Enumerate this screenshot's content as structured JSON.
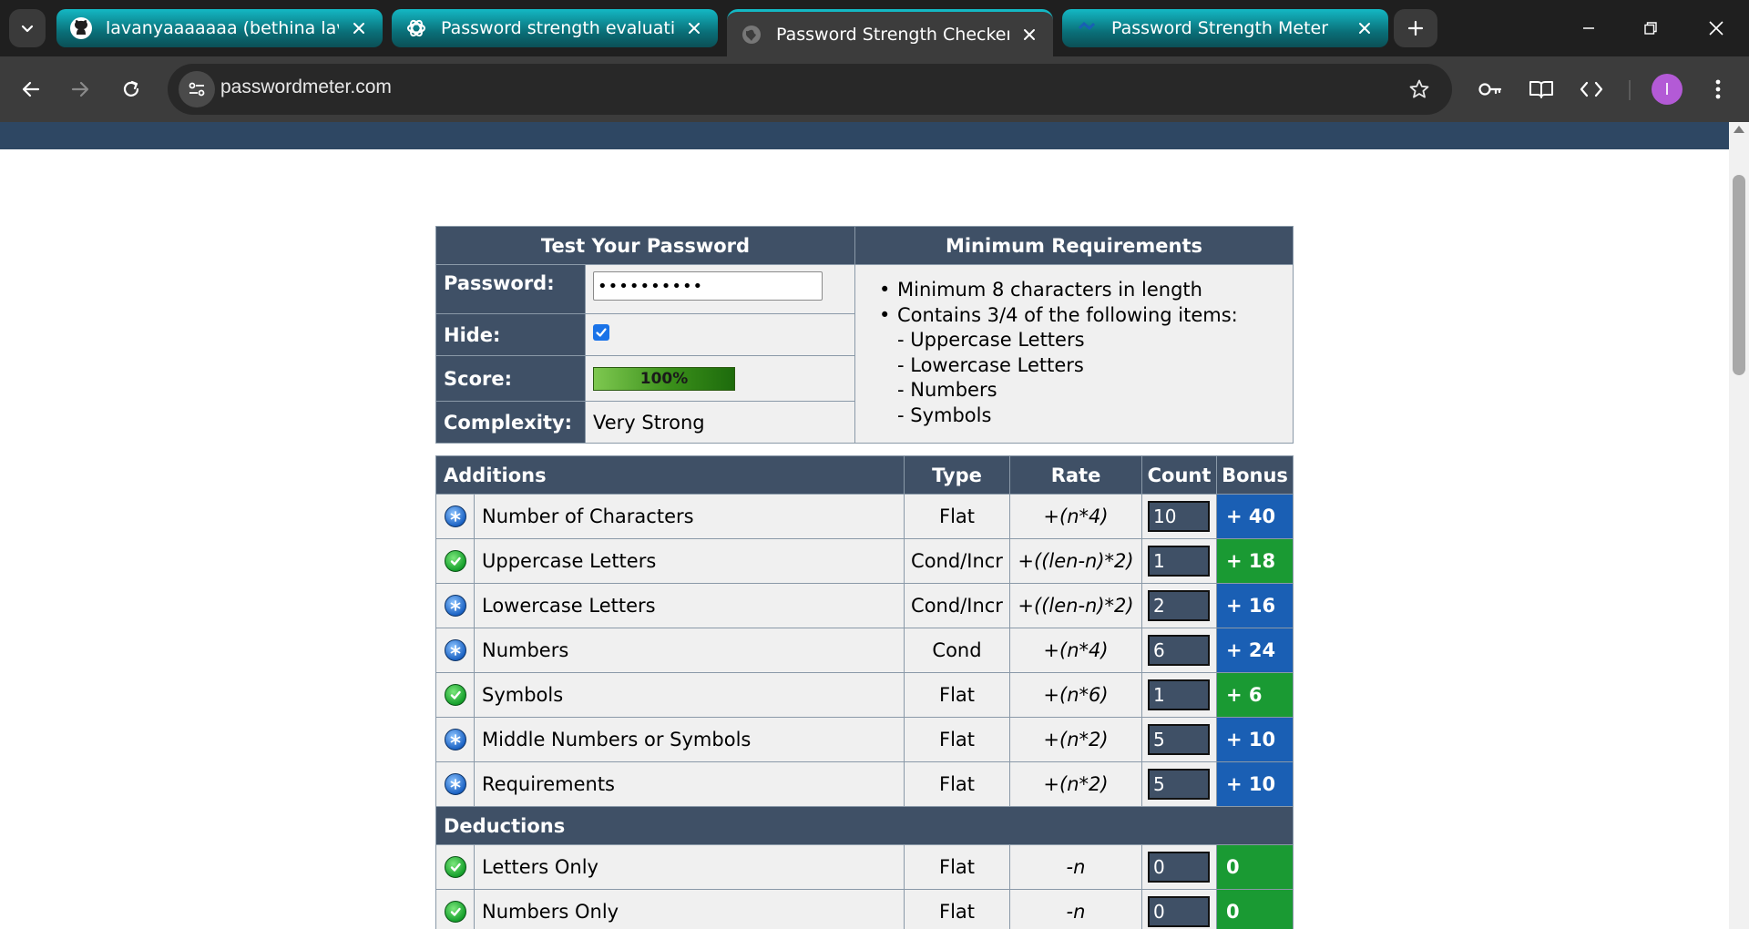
{
  "browser": {
    "tabs": [
      {
        "title": "lavanyaaaaaaa (bethina lavanya",
        "favicon": "github-icon",
        "style": "green"
      },
      {
        "title": "Password strength evaluation",
        "favicon": "openai-icon",
        "style": "green"
      },
      {
        "title": "Password Strength Checker",
        "favicon": "globe-icon",
        "style": "active"
      },
      {
        "title": "Password Strength Meter",
        "favicon": "site-icon",
        "style": "green"
      }
    ],
    "url": "passwordmeter.com",
    "profile_initial": "I",
    "accent_color": "#14b8c4"
  },
  "test_panel": {
    "header": "Test Your Password",
    "password_label": "Password:",
    "password_value": "••••••••••",
    "hide_label": "Hide:",
    "hide_checked": true,
    "score_label": "Score:",
    "score_text": "100%",
    "score_fraction": 1.0,
    "complexity_label": "Complexity:",
    "complexity_value": "Very Strong"
  },
  "requirements": {
    "header": "Minimum Requirements",
    "items": [
      "Minimum 8 characters in length",
      "Contains 3/4 of the following items:"
    ],
    "subitems": [
      "- Uppercase Letters",
      "- Lowercase Letters",
      "- Numbers",
      "- Symbols"
    ]
  },
  "additions": {
    "header": "Additions",
    "columns": {
      "type": "Type",
      "rate": "Rate",
      "count": "Count",
      "bonus": "Bonus"
    },
    "rows": [
      {
        "icon": "blue",
        "name": "Number of Characters",
        "type": "Flat",
        "rate": "+(n*4)",
        "count": "10",
        "bonus": "+ 40"
      },
      {
        "icon": "green",
        "name": "Uppercase Letters",
        "type": "Cond/Incr",
        "rate": "+((len-n)*2)",
        "count": "1",
        "bonus": "+ 18"
      },
      {
        "icon": "blue",
        "name": "Lowercase Letters",
        "type": "Cond/Incr",
        "rate": "+((len-n)*2)",
        "count": "2",
        "bonus": "+ 16"
      },
      {
        "icon": "blue",
        "name": "Numbers",
        "type": "Cond",
        "rate": "+(n*4)",
        "count": "6",
        "bonus": "+ 24"
      },
      {
        "icon": "green",
        "name": "Symbols",
        "type": "Flat",
        "rate": "+(n*6)",
        "count": "1",
        "bonus": "+ 6"
      },
      {
        "icon": "blue",
        "name": "Middle Numbers or Symbols",
        "type": "Flat",
        "rate": "+(n*2)",
        "count": "5",
        "bonus": "+ 10"
      },
      {
        "icon": "blue",
        "name": "Requirements",
        "type": "Flat",
        "rate": "+(n*2)",
        "count": "5",
        "bonus": "+ 10"
      }
    ]
  },
  "deductions": {
    "header": "Deductions",
    "rows": [
      {
        "icon": "green",
        "name": "Letters Only",
        "type": "Flat",
        "rate": "-n",
        "count": "0",
        "bonus": "0"
      },
      {
        "icon": "green",
        "name": "Numbers Only",
        "type": "Flat",
        "rate": "-n",
        "count": "0",
        "bonus": "0"
      }
    ]
  }
}
